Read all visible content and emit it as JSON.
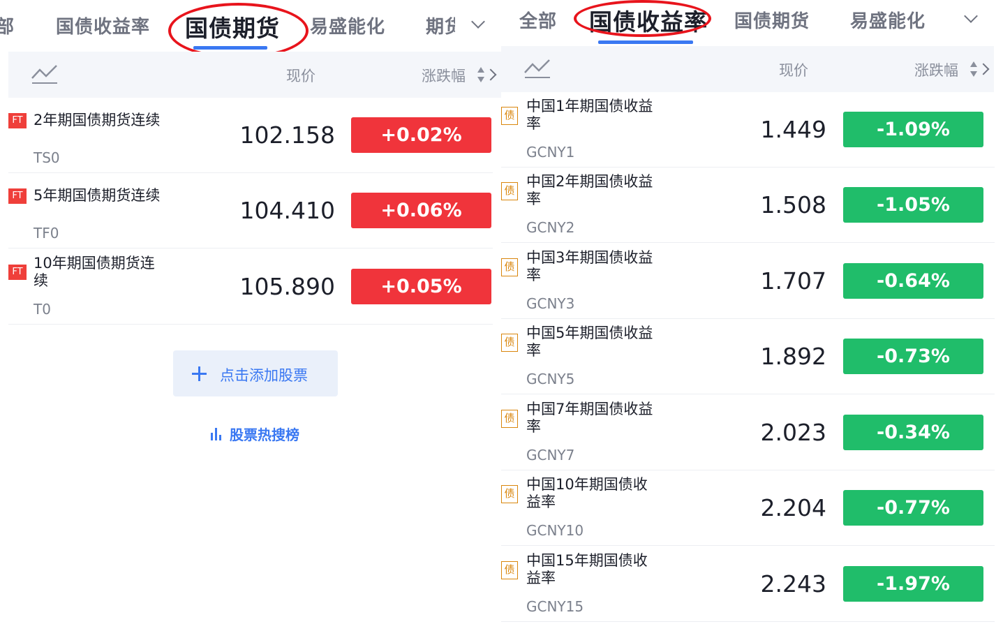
{
  "left": {
    "tabs": [
      {
        "label": "部"
      },
      {
        "label": "国债收益率"
      },
      {
        "label": "国债期货"
      },
      {
        "label": "易盛能化"
      },
      {
        "label": "期货"
      }
    ],
    "header": {
      "price_label": "现价",
      "change_label": "涨跌幅"
    },
    "rows": [
      {
        "badge": "FT",
        "name": "2年期国债期货连续",
        "code": "TS0",
        "price": "102.158",
        "change": "+0.02%"
      },
      {
        "badge": "FT",
        "name": "5年期国债期货连续",
        "code": "TF0",
        "price": "104.410",
        "change": "+0.06%"
      },
      {
        "badge": "FT",
        "name_line1": "10年期国债期货连",
        "name_line2": "续",
        "code": "T0",
        "price": "105.890",
        "change": "+0.05%"
      }
    ],
    "add_button_label": "点击添加股票",
    "hot_list_label": "股票热搜榜"
  },
  "right": {
    "tabs": [
      {
        "label": "全部"
      },
      {
        "label": "国债收益率"
      },
      {
        "label": "国债期货"
      },
      {
        "label": "易盛能化"
      }
    ],
    "header": {
      "price_label": "现价",
      "change_label": "涨跌幅"
    },
    "rows": [
      {
        "badge": "债",
        "name_line1": "中国1年期国债收益",
        "name_line2": "率",
        "code": "GCNY1",
        "price": "1.449",
        "change": "-1.09%"
      },
      {
        "badge": "债",
        "name_line1": "中国2年期国债收益",
        "name_line2": "率",
        "code": "GCNY2",
        "price": "1.508",
        "change": "-1.05%"
      },
      {
        "badge": "债",
        "name_line1": "中国3年期国债收益",
        "name_line2": "率",
        "code": "GCNY3",
        "price": "1.707",
        "change": "-0.64%"
      },
      {
        "badge": "债",
        "name_line1": "中国5年期国债收益",
        "name_line2": "率",
        "code": "GCNY5",
        "price": "1.892",
        "change": "-0.73%"
      },
      {
        "badge": "债",
        "name_line1": "中国7年期国债收益",
        "name_line2": "率",
        "code": "GCNY7",
        "price": "2.023",
        "change": "-0.34%"
      },
      {
        "badge": "债",
        "name_line1": "中国10年期国债收",
        "name_line2": "益率",
        "code": "GCNY10",
        "price": "2.204",
        "change": "-0.77%"
      },
      {
        "badge": "债",
        "name_line1": "中国15年期国债收",
        "name_line2": "益率",
        "code": "GCNY15",
        "price": "2.243",
        "change": "-1.97%"
      }
    ]
  },
  "colors": {
    "up": "#f0343b",
    "down": "#20bd6a",
    "accent": "#3a78f2",
    "highlight": "#e8141c"
  },
  "icons": [
    "trend-line-icon",
    "sort-arrows-icon",
    "chevron-right-icon",
    "chevron-down-icon",
    "plus-icon",
    "bar-chart-icon"
  ]
}
